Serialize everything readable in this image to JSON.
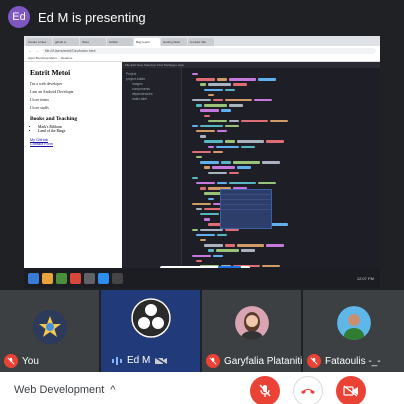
{
  "presenter": {
    "initials": "Ed",
    "text": "Ed M is presenting"
  },
  "shared_screen": {
    "browser_tabs": [
      "Create a New",
      "github.io",
      "Store",
      "Github",
      "Bug report",
      "Getting Start",
      "Contact Tab"
    ],
    "address": "file:///Users/entrit/Dev/index.html",
    "bookmarks": "Apps   Bootstrap Menu   ...   Readme",
    "preview": {
      "title": "Entrit Metoi",
      "line1": "I'm a web developer",
      "line2": "I am an Android Developer",
      "line3": "I love items",
      "line4": "I love staffs",
      "heading2": "Books and Teaching",
      "list": [
        "Mark's Ribbons",
        "Land of the Rings"
      ],
      "link1": "My GitHub",
      "link2": "Contact Form"
    },
    "editor_menu": "File  Edit  View  Selection  Find  Packages  Help",
    "tree": [
      "Project",
      "project-folder",
      "images",
      "components",
      "dependencies",
      "index.html"
    ],
    "toast_text": "meet.google.com is sharing your screen.",
    "toast_button": "Stop sharing",
    "toast_hide": "Hide",
    "clock": "12:07 PM"
  },
  "participants": [
    {
      "name": "You",
      "muted": true
    },
    {
      "name": "Ed M",
      "muted": false
    },
    {
      "name": "Garyfalia Plataniti",
      "muted": true
    },
    {
      "name": "Fataoulis -_-",
      "muted": true
    }
  ],
  "controls": {
    "meeting_name": "Web Development",
    "caret": "^"
  },
  "colors": {
    "red": "#ea4335",
    "stage": "#202124",
    "presenter_tile": "#213a7a",
    "avatar": "#7e57c2"
  }
}
